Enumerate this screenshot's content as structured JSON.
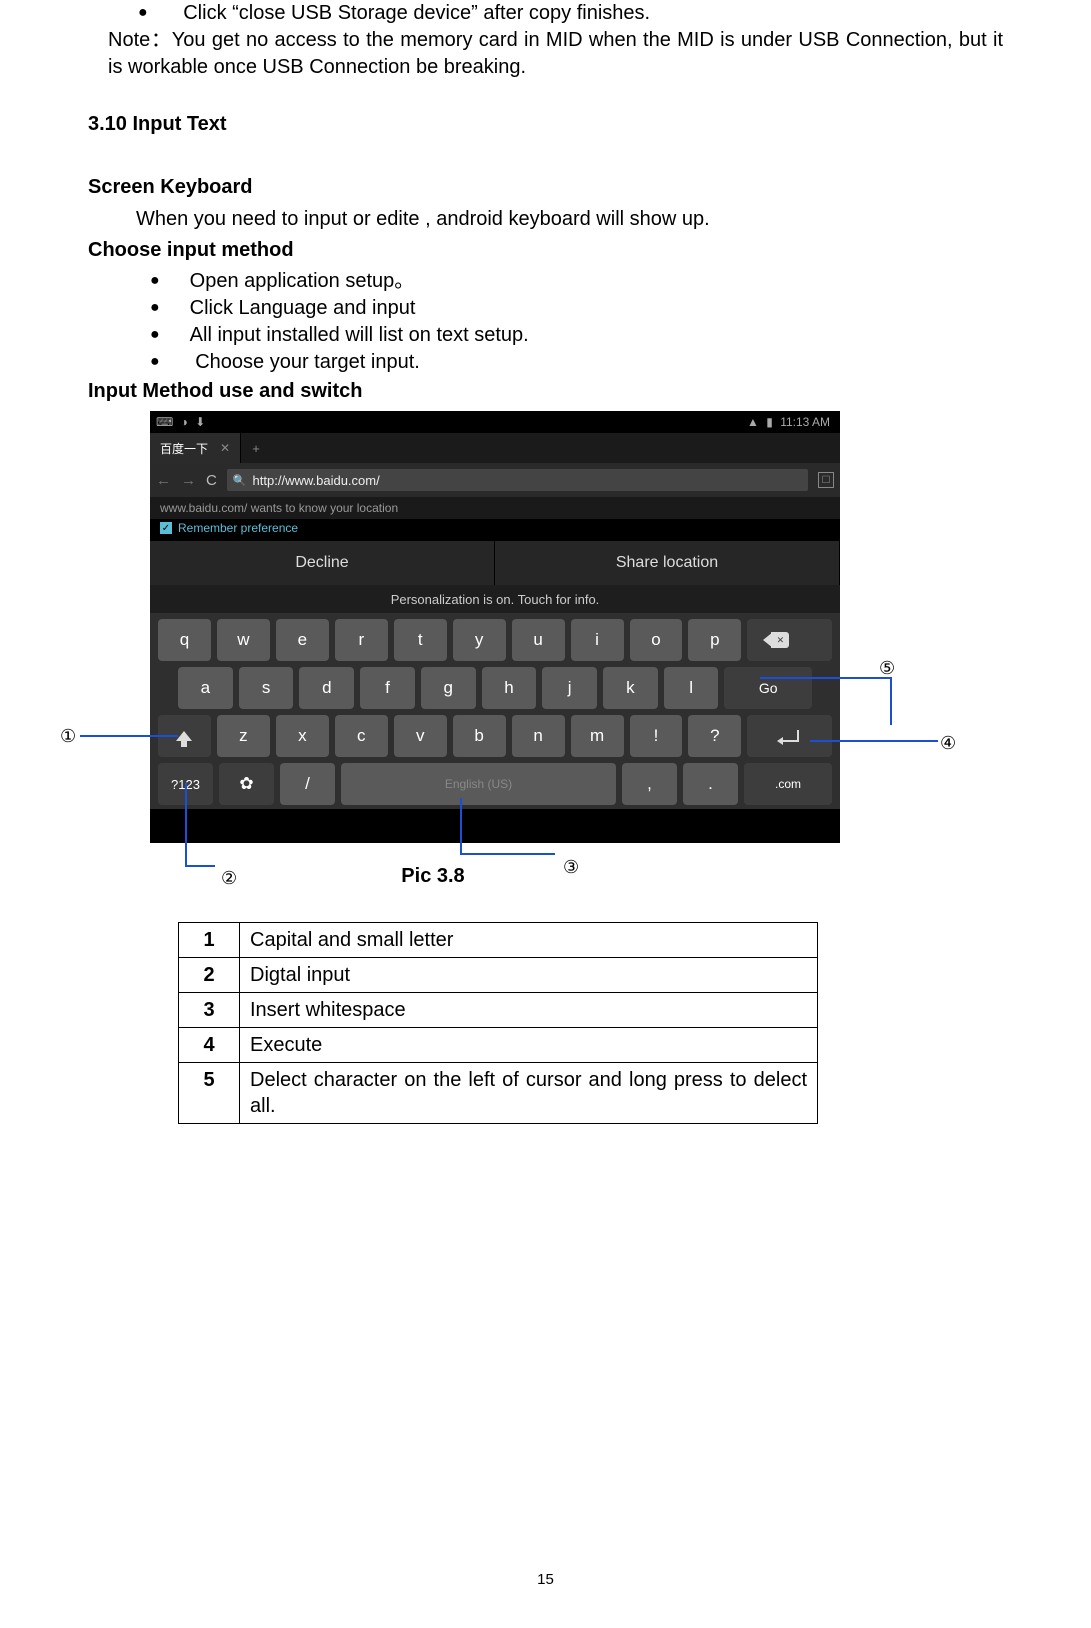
{
  "intro_bullet": "Click “close USB Storage device” after copy finishes.",
  "note_text": "Note：You get no access to the memory card in MID when the MID is under USB Connection, but it is workable once USB Connection be breaking.",
  "section_title": "3.10 Input Text",
  "screen_kb_heading": "Screen Keyboard",
  "screen_kb_para": "When you need to input or edite , android keyboard will show up.",
  "choose_input_heading": "Choose input method",
  "choose_input_bullets": [
    "Open application setup。",
    "Click Language and input",
    "All input installed will list on text setup.",
    " Choose your target input."
  ],
  "switch_heading": "Input Method use and switch",
  "status_time": "11:13 AM",
  "tab_title": "百度一下",
  "url": "http://www.baidu.com/",
  "geo_prompt": "www.baidu.com/ wants to know your location",
  "remember_pref": "Remember preference",
  "decline": "Decline",
  "share_loc": "Share location",
  "hint": "Personalization is on. Touch for info.",
  "kb_rows": {
    "r1": [
      "q",
      "w",
      "e",
      "r",
      "t",
      "y",
      "u",
      "i",
      "o",
      "p"
    ],
    "r2": [
      "a",
      "s",
      "d",
      "f",
      "g",
      "h",
      "j",
      "k",
      "l"
    ],
    "r3": [
      "z",
      "x",
      "c",
      "v",
      "b",
      "n",
      "m",
      "!",
      "?"
    ],
    "go": "Go",
    "num": "?123",
    "slash": "/",
    "space_label": "English (US)",
    "comma": ",",
    "period": ".",
    "com": ".com"
  },
  "pic_label": "Pic 3.8",
  "annotations": [
    "①",
    "②",
    "③",
    "④",
    "⑤"
  ],
  "legend": [
    {
      "n": "1",
      "t": "Capital and small letter"
    },
    {
      "n": "2",
      "t": "Digtal input"
    },
    {
      "n": "3",
      "t": "Insert whitespace"
    },
    {
      "n": "4",
      "t": "Execute"
    },
    {
      "n": "5",
      "t": "Delect character on the left of cursor and long press to delect all."
    }
  ],
  "page_number": "15"
}
